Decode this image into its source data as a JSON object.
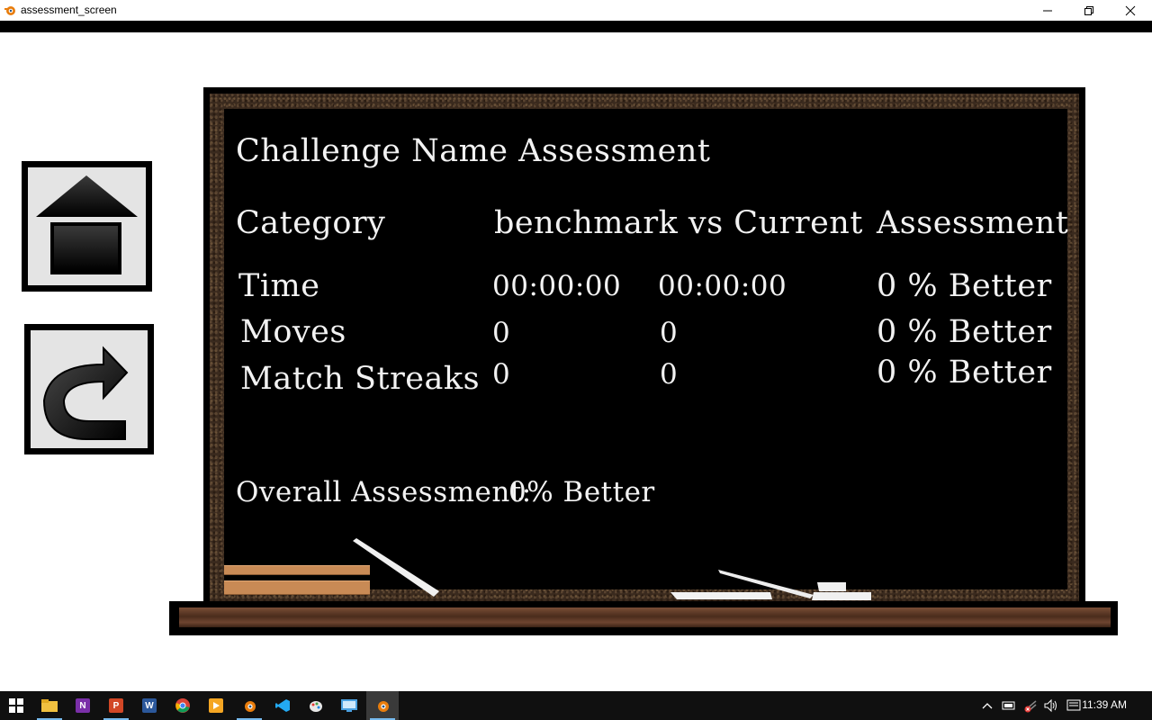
{
  "window": {
    "title": "assessment_screen",
    "minimize_glyph": "minimize-icon",
    "restore_glyph": "restore-icon",
    "close_glyph": "close-icon"
  },
  "nav": {
    "home_icon": "home-icon",
    "retry_icon": "redo-arrow-icon"
  },
  "board": {
    "title": "Challenge Name Assessment",
    "headers": {
      "category": "Category",
      "compare": "benchmark  vs  Current",
      "assessment": "Assessment"
    },
    "rows": [
      {
        "category": "Time",
        "benchmark": "00:00:00",
        "current": "00:00:00",
        "assessment": "0 % Better"
      },
      {
        "category": "Moves",
        "benchmark": "0",
        "current": "0",
        "assessment": "0 % Better"
      },
      {
        "category": "Match Streaks",
        "benchmark": "0",
        "current": "0",
        "assessment": "0 % Better"
      }
    ],
    "overall_label": "Overall Assessment:",
    "overall_value": "0% Better"
  },
  "taskbar": {
    "items": [
      "windows-start-icon",
      "file-explorer-icon",
      "onenote-icon",
      "powerpoint-icon",
      "word-icon",
      "chrome-icon",
      "media-player-icon",
      "blender-icon",
      "vscode-icon",
      "paint-icon",
      "remote-desktop-icon",
      "blender-icon"
    ],
    "active_index": 11,
    "clock": "11:39 AM",
    "colors": {
      "taskbar": "#101010",
      "highlight": "#76b9ed"
    }
  }
}
